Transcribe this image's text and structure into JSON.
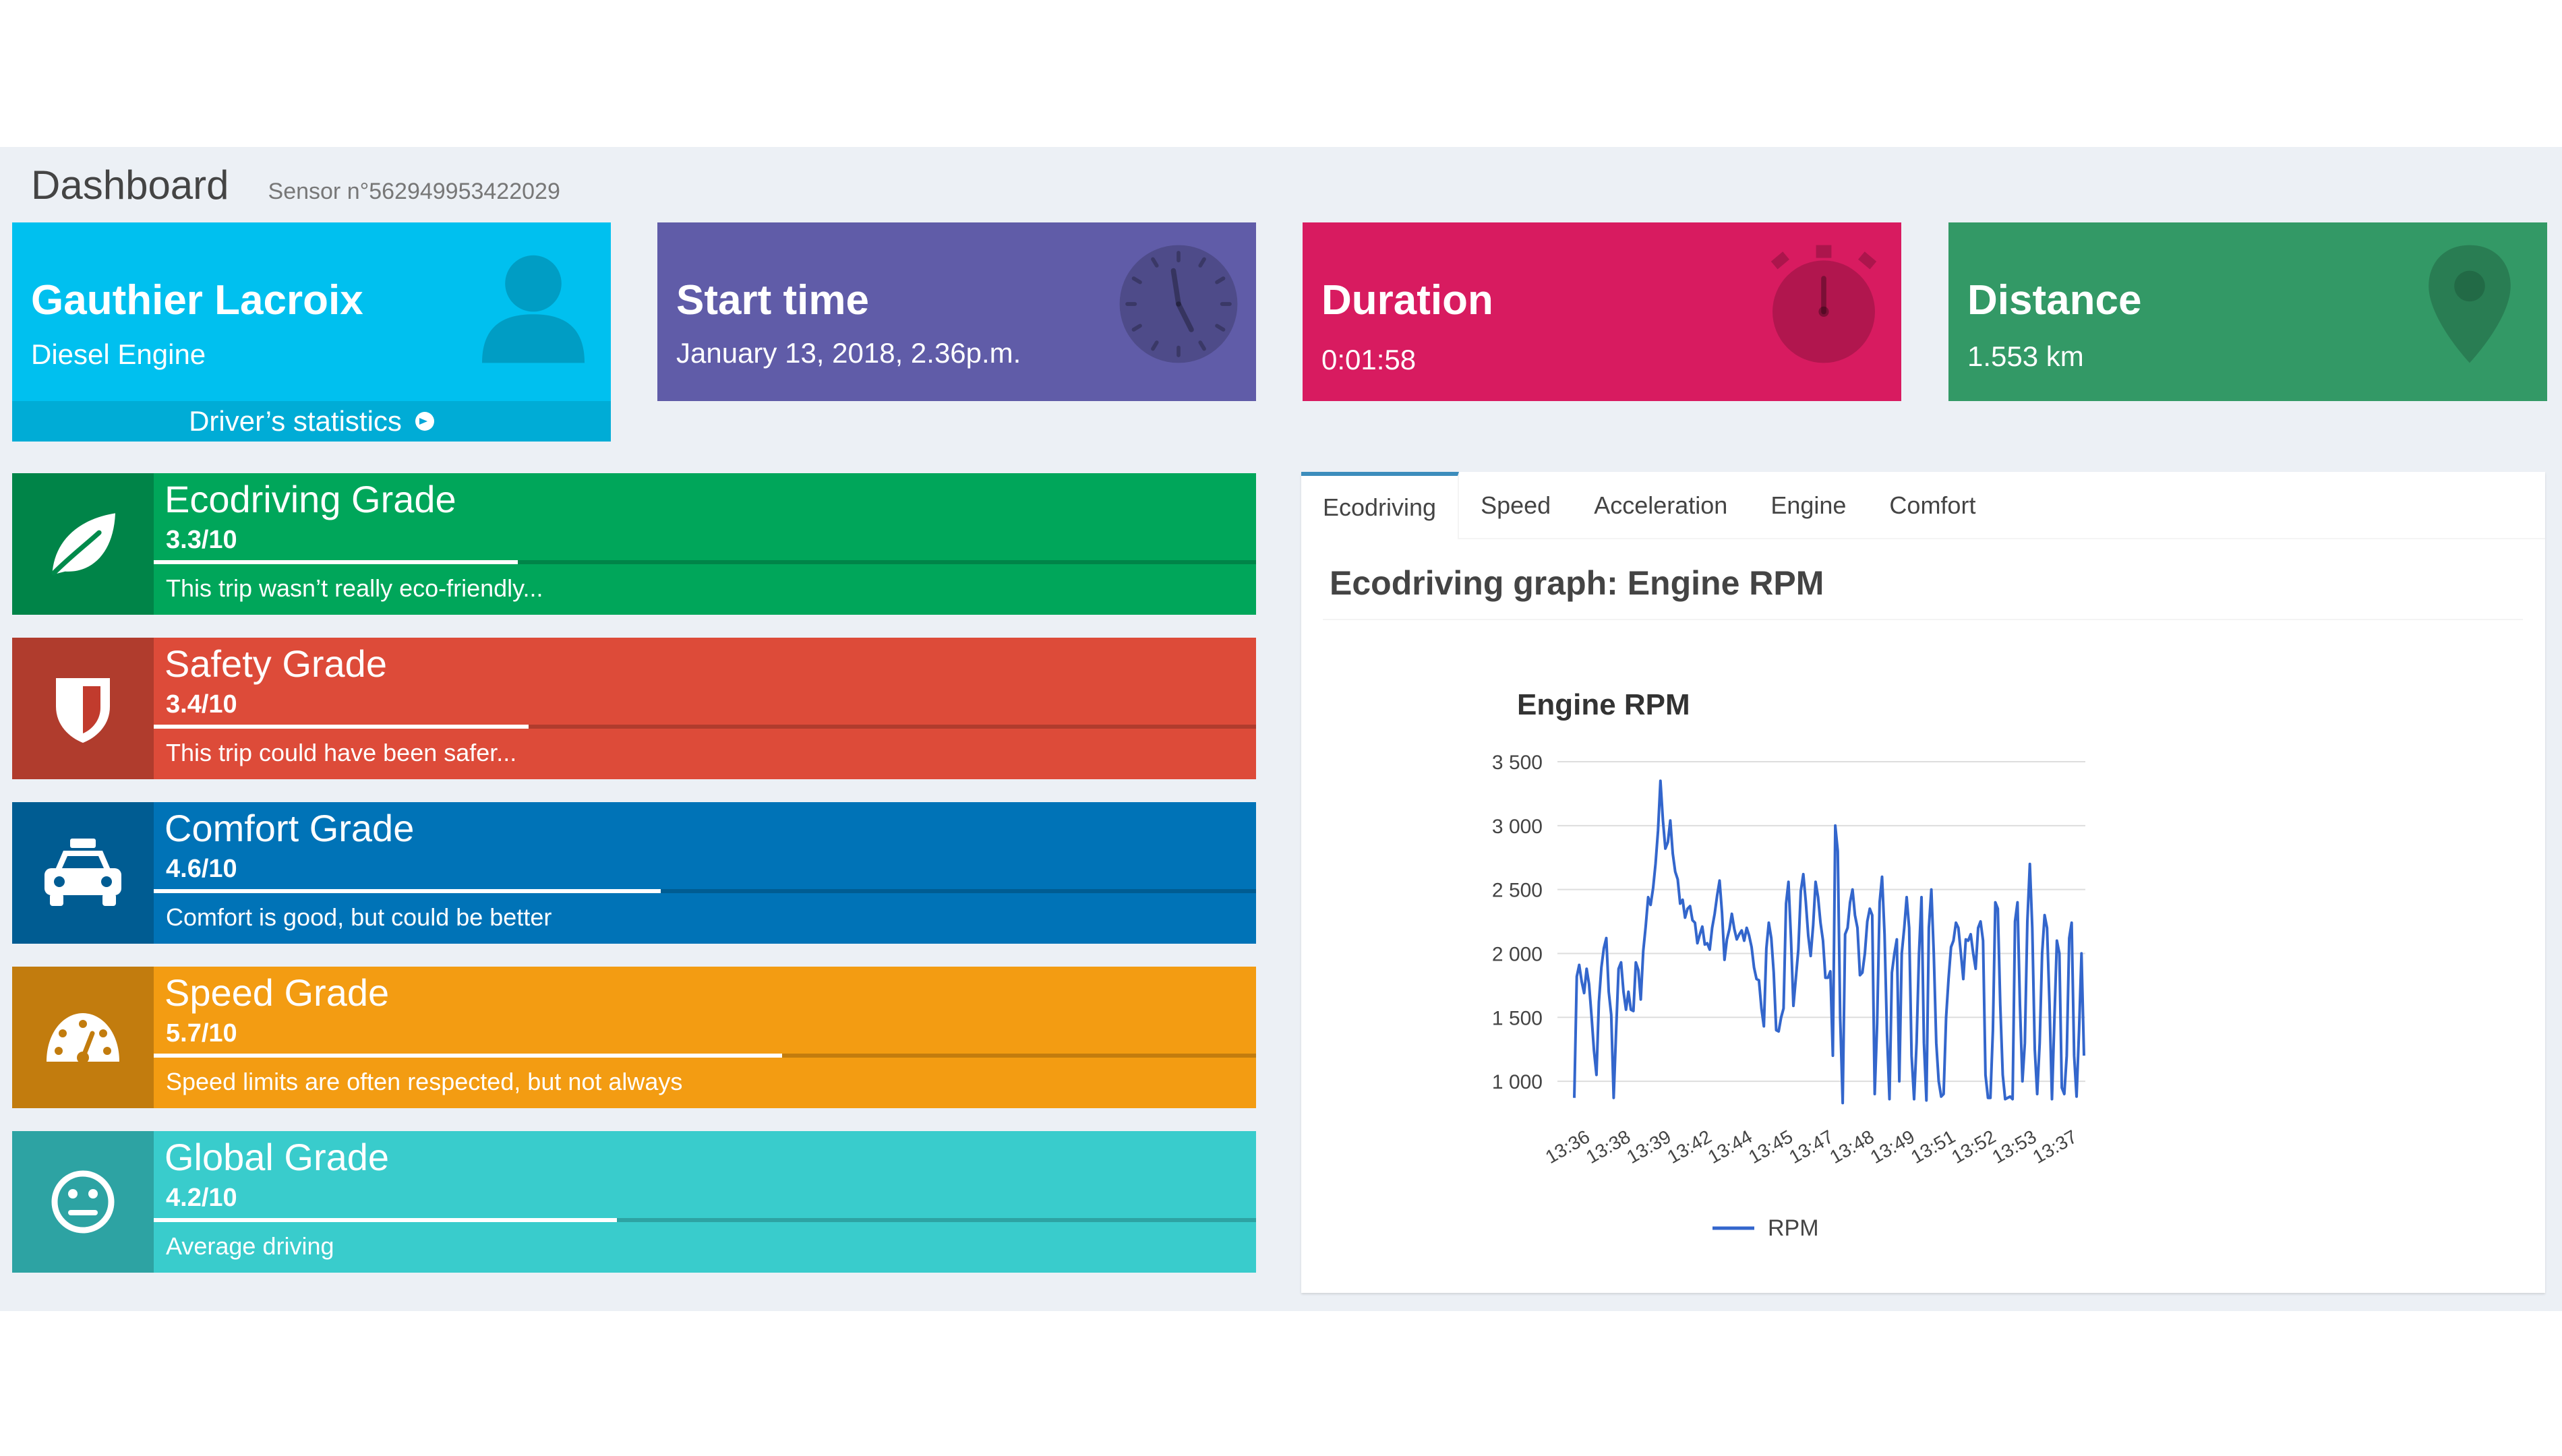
{
  "header": {
    "title": "Dashboard",
    "sensor": "Sensor n°562949953422029"
  },
  "colors": {
    "driver": "#00c0ef",
    "start": "#605ca8",
    "duration": "#d81b60",
    "distance": "#339966",
    "eco": "#00a65a",
    "safety": "#dd4b39",
    "comfort": "#0073b7",
    "speed": "#f39c12",
    "global": "#39cccc",
    "line": "#3366cc"
  },
  "info_boxes": {
    "driver": {
      "name": "Gauthier Lacroix",
      "engine": "Diesel Engine",
      "link": "Driver’s statistics",
      "icon": "user-icon"
    },
    "start": {
      "label": "Start time",
      "value": "January 13, 2018, 2.36p.m.",
      "icon": "clock-icon"
    },
    "duration": {
      "label": "Duration",
      "value": "0:01:58",
      "icon": "stopwatch-icon"
    },
    "distance": {
      "label": "Distance",
      "value": "1.553 km",
      "icon": "map-marker-icon"
    }
  },
  "grades": [
    {
      "id": "eco",
      "title": "Ecodriving Grade",
      "value": "3.3/10",
      "score": 3.3,
      "desc": "This trip wasn’t really eco-friendly...",
      "icon": "leaf-icon"
    },
    {
      "id": "safety",
      "title": "Safety Grade",
      "value": "3.4/10",
      "score": 3.4,
      "desc": "This trip could have been safer...",
      "icon": "shield-icon"
    },
    {
      "id": "comfort",
      "title": "Comfort Grade",
      "value": "4.6/10",
      "score": 4.6,
      "desc": "Comfort is good, but could be better",
      "icon": "taxi-icon"
    },
    {
      "id": "speed",
      "title": "Speed Grade",
      "value": "5.7/10",
      "score": 5.7,
      "desc": "Speed limits are often respected, but not always",
      "icon": "speedometer-icon"
    },
    {
      "id": "global",
      "title": "Global Grade",
      "value": "4.2/10",
      "score": 4.2,
      "desc": "Average driving",
      "icon": "neutral-face-icon"
    }
  ],
  "tabs": [
    "Ecodriving",
    "Speed",
    "Acceleration",
    "Engine",
    "Comfort"
  ],
  "active_tab": 0,
  "panel": {
    "title": "Ecodriving graph: Engine RPM"
  },
  "chart_data": {
    "type": "line",
    "title": "Engine RPM",
    "xlabel": "",
    "ylabel": "",
    "ylim": [
      800,
      3500
    ],
    "yticks": [
      1000,
      1500,
      2000,
      2500,
      3000,
      3500
    ],
    "ytick_labels": [
      "1 000",
      "1 500",
      "2 000",
      "2 500",
      "3 000",
      "3 500"
    ],
    "xtick_labels": [
      "13:36",
      "13:38",
      "13:39",
      "13:42",
      "13:44",
      "13:45",
      "13:47",
      "13:48",
      "13:49",
      "13:51",
      "13:52",
      "13:53",
      "13:37"
    ],
    "grid": true,
    "legend": "bottom",
    "series": [
      {
        "name": "RPM",
        "values": [
          870,
          1820,
          1910,
          1780,
          1690,
          1880,
          1760,
          1510,
          1240,
          1050,
          1620,
          1890,
          2040,
          2120,
          1700,
          1520,
          870,
          1400,
          1880,
          1930,
          1700,
          1560,
          1700,
          1560,
          1550,
          1930,
          1870,
          1640,
          2020,
          2210,
          2440,
          2380,
          2510,
          2700,
          2960,
          3350,
          3040,
          2820,
          2870,
          3040,
          2780,
          2640,
          2580,
          2390,
          2420,
          2280,
          2350,
          2370,
          2260,
          2240,
          2080,
          2150,
          2210,
          2070,
          2080,
          2030,
          2200,
          2310,
          2450,
          2570,
          2320,
          1950,
          2110,
          2190,
          2310,
          2190,
          2110,
          2150,
          2180,
          2100,
          2200,
          2140,
          2050,
          1890,
          1800,
          1790,
          1570,
          1430,
          2040,
          2240,
          2120,
          1850,
          1400,
          1390,
          1500,
          1570,
          2390,
          2560,
          2120,
          1590,
          1810,
          2030,
          2490,
          2620,
          2410,
          2140,
          1980,
          2220,
          2560,
          2440,
          2240,
          2100,
          1810,
          1810,
          1860,
          1200,
          3000,
          2800,
          1500,
          830,
          2150,
          2200,
          2400,
          2500,
          2300,
          2200,
          1830,
          1850,
          2000,
          2250,
          2350,
          2300,
          900,
          1450,
          2400,
          2600,
          2150,
          1380,
          860,
          1850,
          2000,
          2110,
          1000,
          2000,
          2200,
          2440,
          2200,
          1200,
          860,
          1300,
          2000,
          2440,
          1300,
          850,
          2200,
          2500,
          2000,
          1300,
          1000,
          880,
          900,
          1500,
          1800,
          2050,
          2100,
          2240,
          2200,
          2000,
          1800,
          2110,
          2100,
          2150,
          2000,
          1880,
          2200,
          2250,
          2100,
          1050,
          870,
          870,
          1400,
          2400,
          2350,
          1600,
          1050,
          860,
          870,
          880,
          860,
          2250,
          2400,
          1600,
          1000,
          1300,
          2250,
          2700,
          2200,
          1250,
          900,
          1300,
          2000,
          2300,
          2200,
          1600,
          860,
          1500,
          2100,
          2000,
          950,
          900,
          1200,
          2120,
          2240,
          1200,
          880,
          1400,
          2000,
          1200
        ]
      }
    ]
  }
}
